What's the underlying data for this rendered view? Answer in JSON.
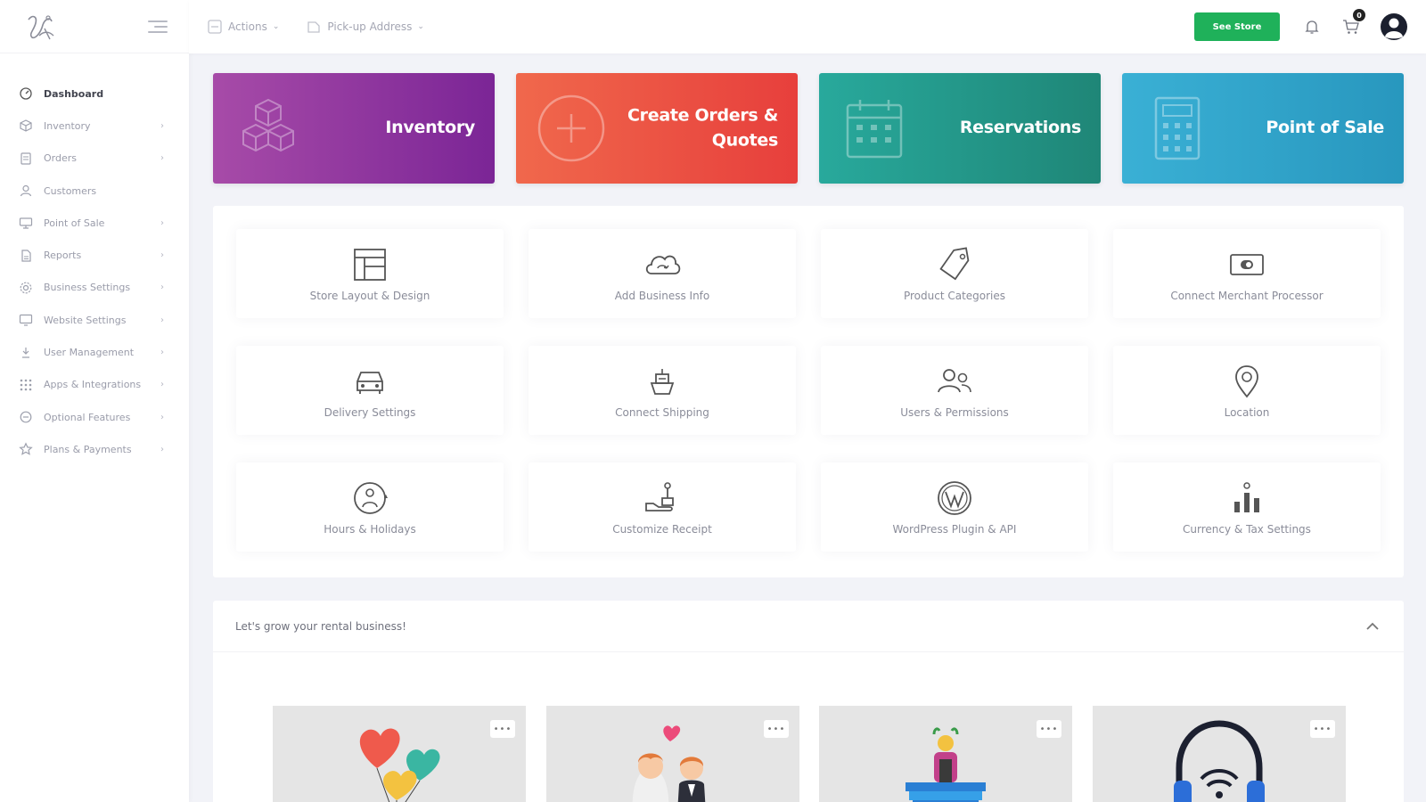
{
  "sidebar": {
    "items": [
      {
        "label": "Dashboard",
        "icon": "dashboard-icon",
        "active": true
      },
      {
        "label": "Inventory",
        "icon": "inventory-icon"
      },
      {
        "label": "Orders",
        "icon": "orders-icon"
      },
      {
        "label": "Customers",
        "icon": "customers-icon"
      },
      {
        "label": "Point of Sale",
        "icon": "pos-icon"
      },
      {
        "label": "Reports",
        "icon": "reports-icon"
      },
      {
        "label": "Business Settings",
        "icon": "business-settings-icon"
      },
      {
        "label": "Website Settings",
        "icon": "website-settings-icon"
      },
      {
        "label": "User Management",
        "icon": "user-management-icon"
      },
      {
        "label": "Apps & Integrations",
        "icon": "apps-icon"
      },
      {
        "label": "Optional Features",
        "icon": "optional-features-icon"
      },
      {
        "label": "Plans & Payments",
        "icon": "plans-icon"
      }
    ]
  },
  "topbar": {
    "actions_label": "Actions",
    "pickup_label": "Pick-up Address",
    "see_store_label": "See Store",
    "cart_count": "0"
  },
  "tiles": {
    "inventory": "Inventory",
    "create_orders_line1": "Create Orders &",
    "create_orders_line2": "Quotes",
    "reservations": "Reservations",
    "pos": "Point of Sale"
  },
  "settings": [
    {
      "label": "Store Layout & Design",
      "icon": "layout-icon"
    },
    {
      "label": "Add Business Info",
      "icon": "cloud-icon"
    },
    {
      "label": "Product Categories",
      "icon": "tag-icon"
    },
    {
      "label": "Connect Merchant Processor",
      "icon": "card-icon"
    },
    {
      "label": "Delivery Settings",
      "icon": "car-icon"
    },
    {
      "label": "Connect Shipping",
      "icon": "ship-icon"
    },
    {
      "label": "Users & Permissions",
      "icon": "users-icon"
    },
    {
      "label": "Location",
      "icon": "location-pin-icon"
    },
    {
      "label": "Hours & Holidays",
      "icon": "clock-icon"
    },
    {
      "label": "Customize Receipt",
      "icon": "receipt-icon"
    },
    {
      "label": "WordPress Plugin & API",
      "icon": "wordpress-icon"
    },
    {
      "label": "Currency & Tax Settings",
      "icon": "currency-icon"
    }
  ],
  "grow": {
    "title": "Let's grow your rental business!",
    "menu_dots": "•••"
  },
  "colors": {
    "inventory_tile": "#8e35a0",
    "orders_tile": "#ec5344",
    "reservations_tile": "#249a8c",
    "pos_tile": "#32a6cb",
    "see_store": "#1fb15a"
  }
}
